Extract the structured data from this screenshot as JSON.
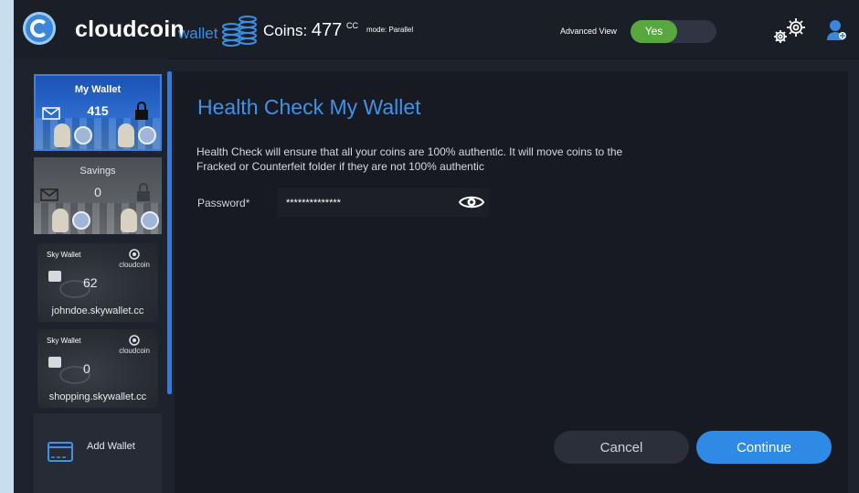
{
  "header": {
    "brand": "cloudcoin",
    "brand_sub": "wallet",
    "coins_label": "Coins:",
    "coins_value": "477",
    "coins_unit": "CC",
    "mode": "mode: Parallel",
    "advanced_view_label": "Advanced View",
    "advanced_view_toggle": "Yes"
  },
  "sidebar": {
    "wallets": [
      {
        "name": "My Wallet",
        "count": "415"
      },
      {
        "name": "Savings",
        "count": "0"
      }
    ],
    "sky_wallets": [
      {
        "label": "Sky Wallet",
        "brand": "cloudcoin",
        "count": "62",
        "email": "johndoe.skywallet.cc"
      },
      {
        "label": "Sky Wallet",
        "brand": "cloudcoin",
        "count": "0",
        "email": "shopping.skywallet.cc"
      }
    ],
    "add_wallet": "Add Wallet"
  },
  "main": {
    "title": "Health Check My Wallet",
    "description": "Health Check will ensure that all your coins are 100% authentic. It will move coins to the Fracked or Counterfeit folder if they are not 100% authentic",
    "password_label": "Password*",
    "password_value": "**************",
    "cancel": "Cancel",
    "continue": "Continue"
  },
  "colors": {
    "accent": "#2f8ae6",
    "toggle_on": "#58a83f",
    "background": "#171a22"
  }
}
